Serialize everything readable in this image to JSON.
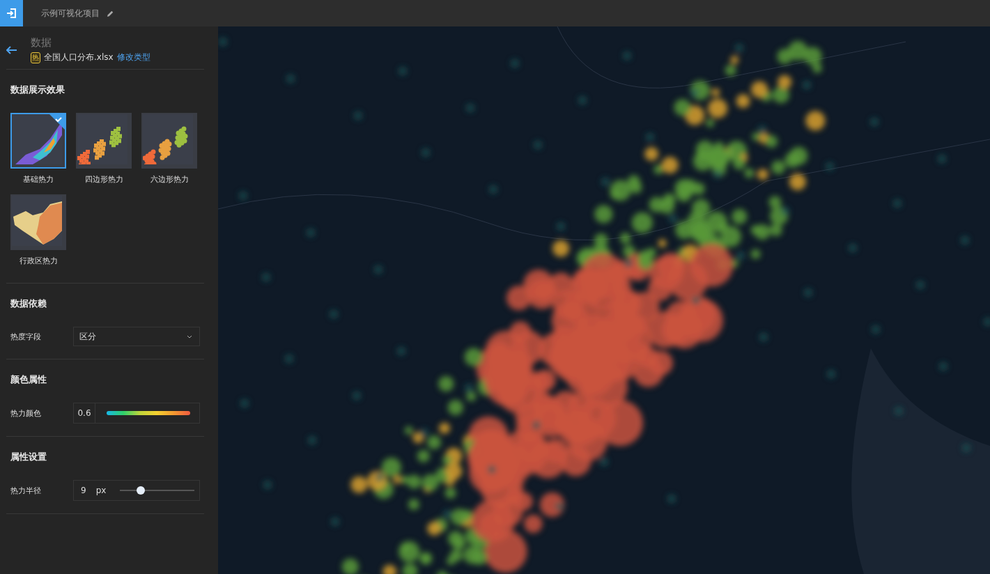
{
  "top_bar": {
    "project_title": "示例可视化项目"
  },
  "data_header": {
    "title": "数据",
    "badge": "热",
    "file_name": "全国人口分布.xlsx",
    "link": "修改类型"
  },
  "display_section": {
    "title": "数据展示效果",
    "options": [
      {
        "label": "基础热力",
        "kind": "basic",
        "selected": true
      },
      {
        "label": "四边形热力",
        "kind": "grid",
        "selected": false
      },
      {
        "label": "六边形热力",
        "kind": "hex",
        "selected": false
      },
      {
        "label": "行政区热力",
        "kind": "region",
        "selected": false
      }
    ]
  },
  "dependency_section": {
    "title": "数据依赖",
    "field_label": "热度字段",
    "field_value": "区分"
  },
  "color_section": {
    "title": "颜色属性",
    "label": "热力颜色",
    "opacity": "0.6"
  },
  "attribute_section": {
    "title": "属性设置",
    "label": "热力半径",
    "value": "9",
    "unit": "px",
    "level": 0.28
  }
}
